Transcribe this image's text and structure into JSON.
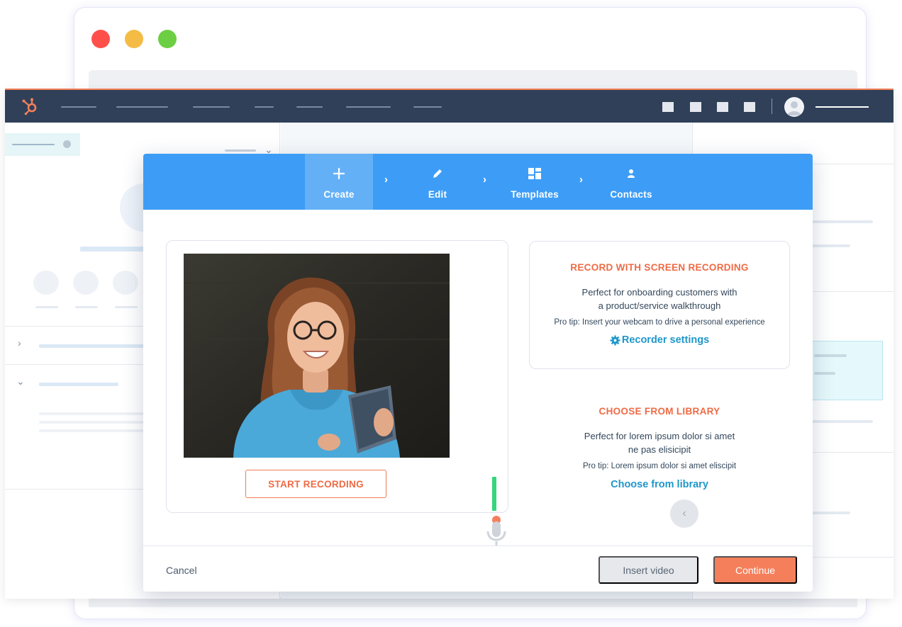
{
  "stepper": {
    "steps": [
      {
        "label": "Create",
        "icon": "plus-icon",
        "active": true
      },
      {
        "label": "Edit",
        "icon": "pencil-icon",
        "active": false
      },
      {
        "label": "Templates",
        "icon": "templates-icon",
        "active": false
      },
      {
        "label": "Contacts",
        "icon": "contact-icon",
        "active": false
      }
    ]
  },
  "camera": {
    "start_label": "START RECORDING"
  },
  "screen_recording": {
    "title": "RECORD WITH SCREEN RECORDING",
    "desc_line1": "Perfect for onboarding customers with",
    "desc_line2": "a product/service walkthrough",
    "tip": "Pro tip: Insert your webcam to drive a personal experience",
    "link": "Recorder settings",
    "link_icon": "gear-icon"
  },
  "library": {
    "title": "CHOOSE FROM LIBRARY",
    "desc_line1": "Perfect for lorem ipsum dolor si amet",
    "desc_line2": "ne pas elisicipit",
    "tip": "Pro tip: Lorem ipsum dolor si amet eliscipit",
    "link": "Choose from library"
  },
  "footer": {
    "cancel": "Cancel",
    "insert": "Insert video",
    "continue": "Continue"
  },
  "colors": {
    "stepper_bg": "#3d9df6",
    "accent_orange": "#f57f5b",
    "link_blue": "#1e97c8",
    "nav_bg": "#2f4058"
  }
}
